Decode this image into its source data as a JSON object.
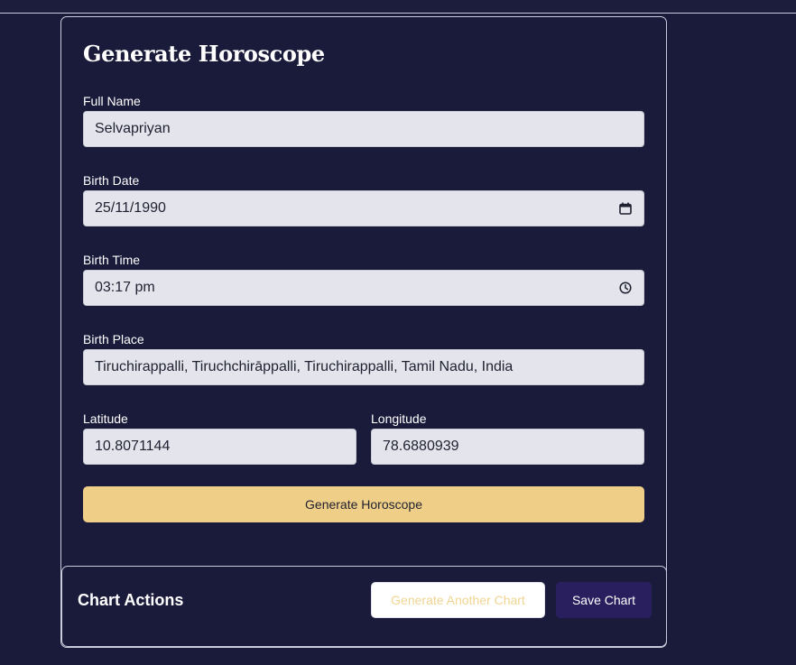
{
  "form": {
    "title": "Generate Horoscope",
    "full_name": {
      "label": "Full Name",
      "value": "Selvapriyan"
    },
    "birth_date": {
      "label": "Birth Date",
      "value": "25/11/1990",
      "icon": "calendar-icon"
    },
    "birth_time": {
      "label": "Birth Time",
      "value": "03:17 pm",
      "icon": "clock-icon"
    },
    "birth_place": {
      "label": "Birth Place",
      "value": "Tiruchirappalli, Tiruchchirāppalli, Tiruchirappalli, Tamil Nadu, India"
    },
    "latitude": {
      "label": "Latitude",
      "value": "10.8071144"
    },
    "longitude": {
      "label": "Longitude",
      "value": "78.6880939"
    },
    "submit_label": "Generate Horoscope"
  },
  "actions": {
    "title": "Chart Actions",
    "generate_another_label": "Generate Another Chart",
    "save_label": "Save Chart"
  },
  "colors": {
    "background": "#1a1b3a",
    "field_bg": "#e4e5ec",
    "primary_button": "#efcf88",
    "save_button": "#2a1f5e"
  }
}
